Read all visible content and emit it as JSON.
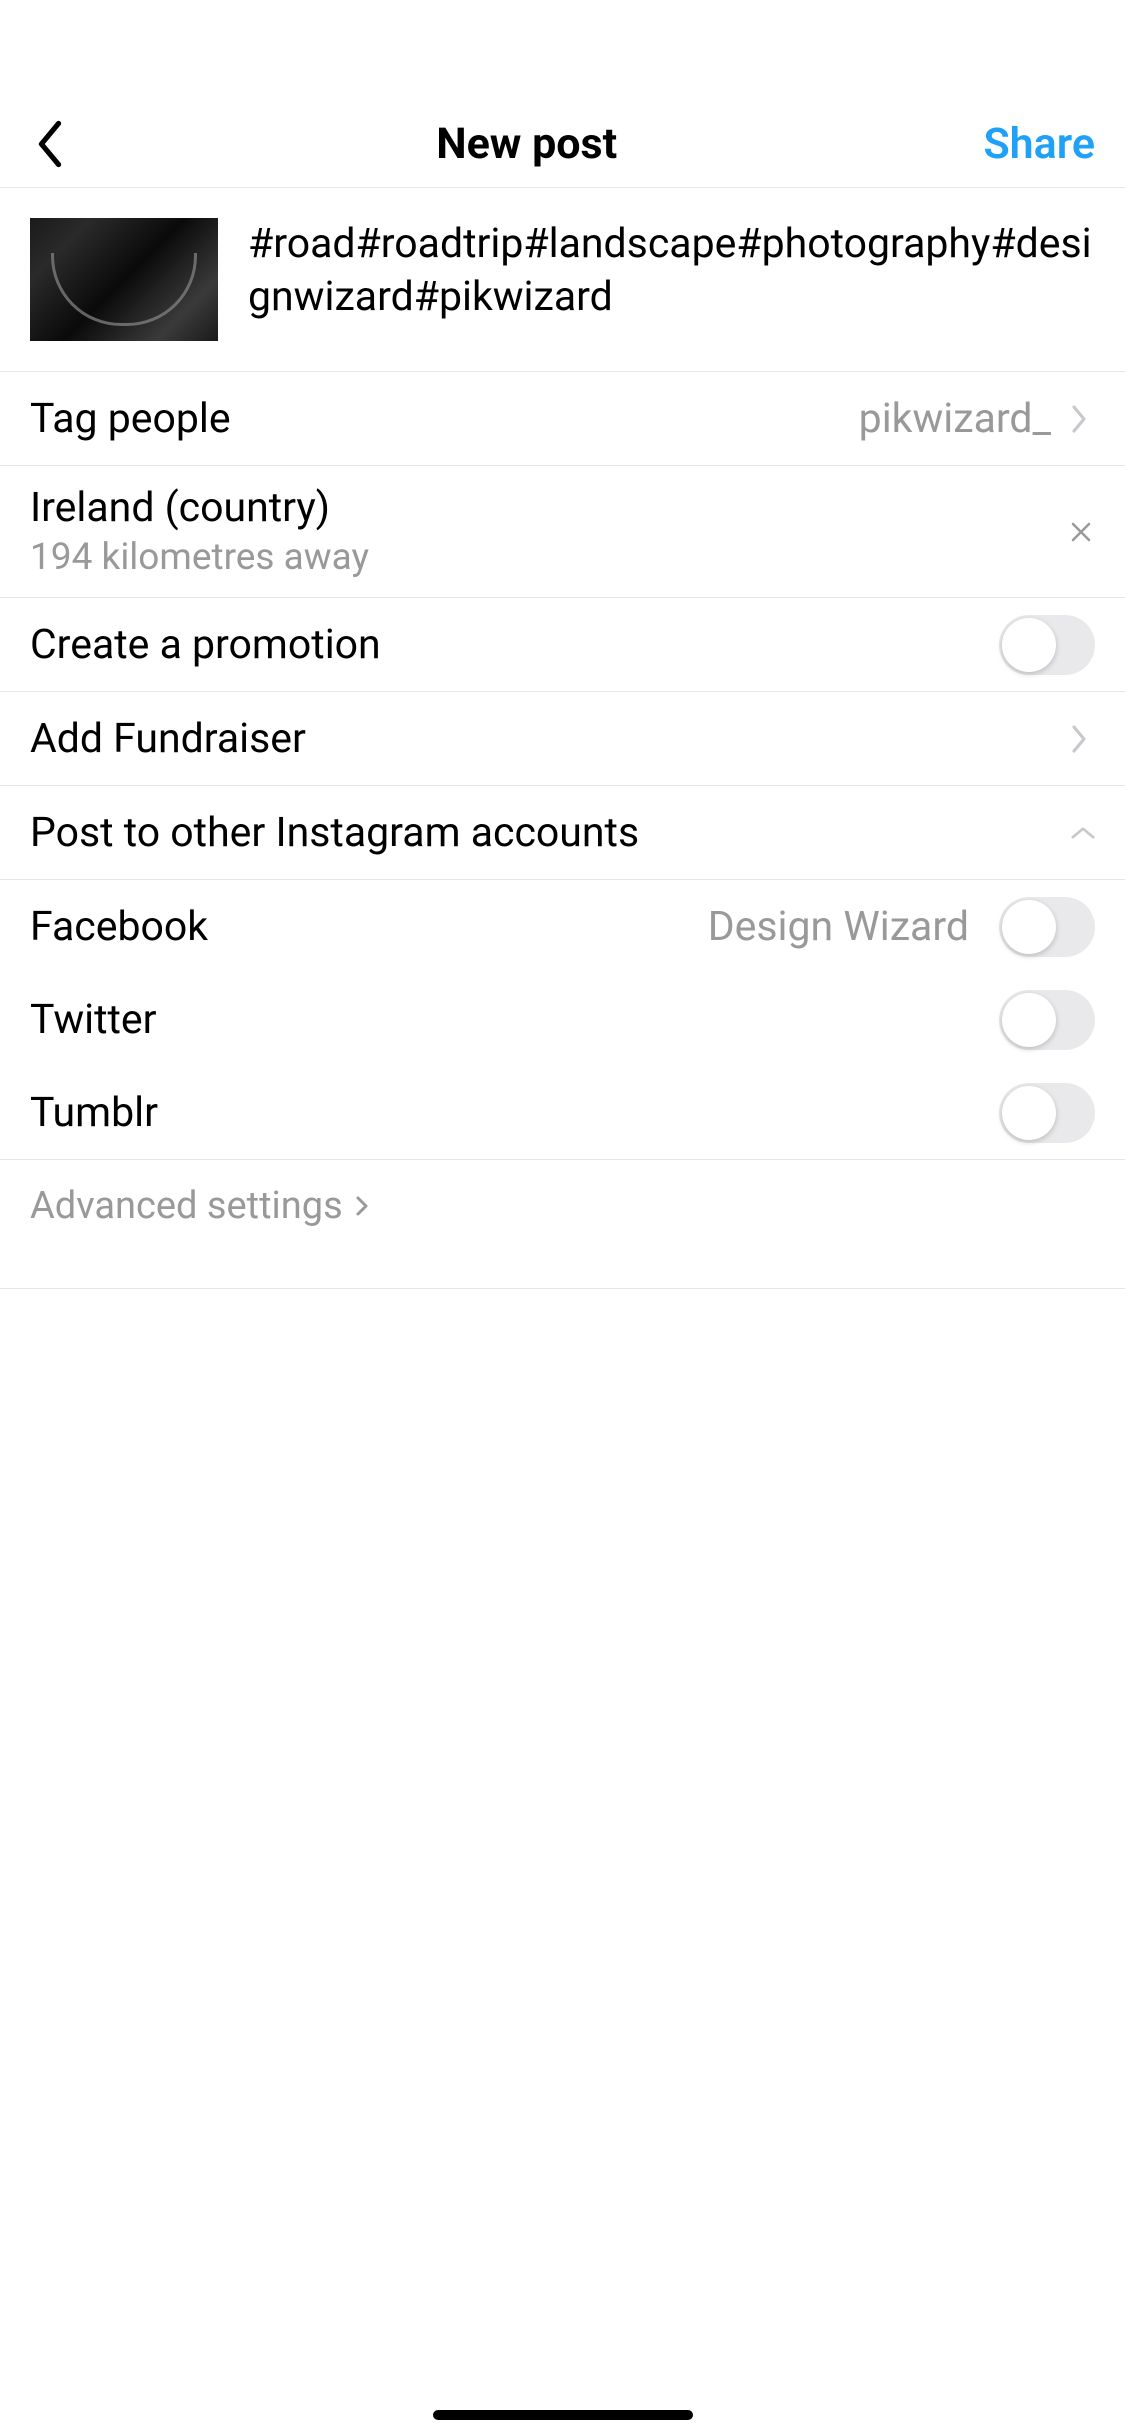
{
  "header": {
    "title": "New post",
    "share_label": "Share"
  },
  "caption": "#road#roadtrip#landscape#photography#designwizard#pikwizard",
  "rows": {
    "tag_people": {
      "label": "Tag people",
      "value": "pikwizard_"
    },
    "location": {
      "name": "Ireland (country)",
      "distance": "194 kilometres away"
    },
    "promotion": {
      "label": "Create a promotion"
    },
    "fundraiser": {
      "label": "Add Fundraiser"
    },
    "other_accounts": {
      "label": "Post to other Instagram accounts"
    }
  },
  "share_platforms": {
    "facebook": {
      "label": "Facebook",
      "value": "Design Wizard"
    },
    "twitter": {
      "label": "Twitter"
    },
    "tumblr": {
      "label": "Tumblr"
    }
  },
  "advanced": {
    "label": "Advanced settings"
  }
}
